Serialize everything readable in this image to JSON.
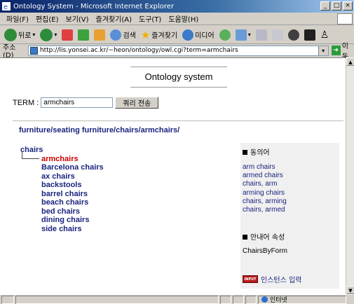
{
  "window": {
    "title": "Ontology System - Microsoft Internet Explorer"
  },
  "menu": [
    "파일(F)",
    "편집(E)",
    "보기(V)",
    "즐겨찾기(A)",
    "도구(T)",
    "도움말(H)"
  ],
  "toolbar": {
    "back": "뒤로",
    "search": "검색",
    "favorites": "즐겨찾기",
    "media": "미디어"
  },
  "address": {
    "label": "주소(D)",
    "url": "http://lis.yonsei.ac.kr/~heon/ontology/owl.cgi?term=armchairs",
    "go": "이동"
  },
  "page": {
    "title": "Ontology system",
    "term_label": "TERM :",
    "term_value": "armchairs",
    "submit_label": "쿼리 전송",
    "path": "furniture/seating furniture/chairs/armchairs/",
    "tree": {
      "root": "chairs",
      "current": "armchairs",
      "children": [
        "Barcelona chairs",
        "ax chairs",
        "backstools",
        "barrel chairs",
        "beach chairs",
        "bed chairs",
        "dining chairs",
        "side chairs"
      ]
    },
    "sidebar": {
      "synonyms_heading": "동의어",
      "synonyms": [
        "arm chairs",
        "armed chairs",
        "chairs, arm",
        "arming chairs",
        "chairs, arming",
        "chairs, armed"
      ],
      "properties_heading": "안내어 속성",
      "property": "ChairsByForm",
      "input_icon_label": "INPUT",
      "instance_link": "인스턴스 입력"
    }
  },
  "status": {
    "zone": "인터넷"
  }
}
